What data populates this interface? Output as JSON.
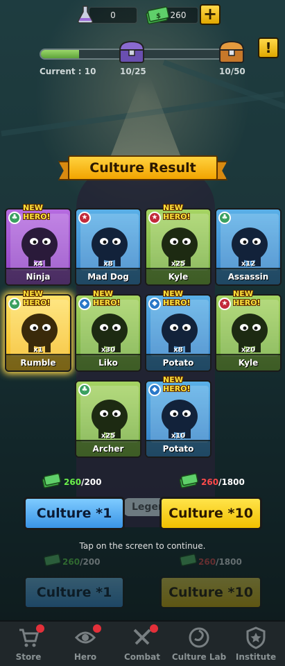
{
  "resources": {
    "flask_value": "0",
    "cash_value": "260",
    "plus_label": "+",
    "alert_label": "!"
  },
  "progress": {
    "current_label": "Current : 10",
    "milestone_1": "10/25",
    "milestone_2": "10/50",
    "fill_fraction": 0.2
  },
  "banner": {
    "title": "Culture Result"
  },
  "new_hero_label": "NEW HERO!",
  "cards": [
    {
      "name": "Ninja",
      "count": "x4",
      "rarity": "purple",
      "role": "support",
      "new": true
    },
    {
      "name": "Mad Dog",
      "count": "x8",
      "rarity": "blue",
      "role": "attack",
      "new": false
    },
    {
      "name": "Kyle",
      "count": "x25",
      "rarity": "green",
      "role": "attack",
      "new": true
    },
    {
      "name": "Assassin",
      "count": "x12",
      "rarity": "blue",
      "role": "support",
      "new": false
    },
    {
      "name": "Rumble",
      "count": "x1",
      "rarity": "yellow",
      "role": "support",
      "new": true
    },
    {
      "name": "Liko",
      "count": "x30",
      "rarity": "green",
      "role": "defense",
      "new": true
    },
    {
      "name": "Potato",
      "count": "x8",
      "rarity": "blue",
      "role": "defense",
      "new": true
    },
    {
      "name": "Kyle",
      "count": "x20",
      "rarity": "green",
      "role": "attack",
      "new": true
    },
    {
      "name": "Archer",
      "count": "x25",
      "rarity": "green",
      "role": "support",
      "new": false
    },
    {
      "name": "Potato",
      "count": "x10",
      "rarity": "blue",
      "role": "defense",
      "new": true
    }
  ],
  "buttons": {
    "culture_1": {
      "label": "Culture *1",
      "have": "260",
      "cost": "/200"
    },
    "culture_10": {
      "label": "Culture *10",
      "have": "260",
      "cost": "/1800"
    },
    "legend_tab": "Legen"
  },
  "tap_text": "Tap on the screen to continue.",
  "nav": [
    {
      "label": "Store",
      "icon": "cart-icon",
      "dot": true
    },
    {
      "label": "Hero",
      "icon": "eye-icon",
      "dot": true
    },
    {
      "label": "Combat",
      "icon": "swords-icon",
      "dot": true
    },
    {
      "label": "Culture Lab",
      "icon": "swirl-icon",
      "dot": false
    },
    {
      "label": "Institute",
      "icon": "shield-star-icon",
      "dot": false
    }
  ],
  "colors": {
    "purple": "#b66be0",
    "blue": "#3a94e6",
    "green": "#8cc04e",
    "yellow": "#f4c818",
    "gold_button": "#f2bf00",
    "ok_text": "#6bf04a",
    "bad_text": "#ff4a4a"
  }
}
